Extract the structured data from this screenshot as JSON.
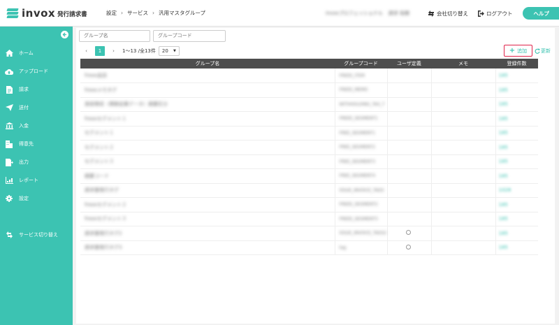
{
  "header": {
    "brand": "invox",
    "product": "発行請求書",
    "breadcrumb": [
      "設定",
      "サービス",
      "汎用マスタグループ"
    ],
    "user_org": "invoxプロフェッショナル",
    "user_name": "請求 佑樹",
    "switch_company": "会社切り替え",
    "logout": "ログアウト",
    "help": "ヘルプ"
  },
  "sidebar": {
    "items": [
      {
        "label": "ホーム",
        "icon": "home-icon"
      },
      {
        "label": "アップロード",
        "icon": "cloud-upload-icon"
      },
      {
        "label": "請求",
        "icon": "document-icon"
      },
      {
        "label": "送付",
        "icon": "send-icon"
      },
      {
        "label": "入金",
        "icon": "bank-icon"
      },
      {
        "label": "得意先",
        "icon": "building-icon"
      },
      {
        "label": "出力",
        "icon": "export-icon"
      },
      {
        "label": "レポート",
        "icon": "chart-icon"
      },
      {
        "label": "設定",
        "icon": "gear-icon"
      },
      {
        "label": "サービス切り替え",
        "icon": "switch-icon"
      }
    ]
  },
  "filters": {
    "group_name_placeholder": "グループ名",
    "group_code_placeholder": "グループコード"
  },
  "pager": {
    "current": "1",
    "info": "1〜13 /全13件",
    "page_size": "20"
  },
  "actions": {
    "add": "追加",
    "refresh": "更新"
  },
  "table": {
    "headers": [
      "グループ名",
      "グループコード",
      "ユーザ定義",
      "メモ",
      "登録件数"
    ],
    "rows": [
      {
        "name": "freee品目",
        "code": "FREEE_ITEM",
        "user_defined": false,
        "memo": "",
        "count": "185"
      },
      {
        "name": "freeeメモタグ",
        "code": "FREEE_MEMO",
        "user_defined": false,
        "memo": "",
        "count": "185"
      },
      {
        "name": "源泉徴収（債務従業データ）摘要区分",
        "code": "WITHHOLDING_TAX_T",
        "user_defined": false,
        "memo": "",
        "count": "185"
      },
      {
        "name": "freeeセグメント１",
        "code": "FREEE_SEGMENT1",
        "user_defined": false,
        "memo": "",
        "count": "185"
      },
      {
        "name": "セグメント１",
        "code": "FREE_SEGMENT1",
        "user_defined": false,
        "memo": "",
        "count": "185"
      },
      {
        "name": "セグメント２",
        "code": "FREE_SEGMENT2",
        "user_defined": false,
        "memo": "",
        "count": "185"
      },
      {
        "name": "セグメント３",
        "code": "FREE_SEGMENT3",
        "user_defined": false,
        "memo": "",
        "count": "185"
      },
      {
        "name": "摘要コード",
        "code": "FREE_SEGMENT4",
        "user_defined": false,
        "memo": "",
        "count": "185"
      },
      {
        "name": "請求書発行タグ",
        "code": "ISSUE_INVOICE_TAGS",
        "user_defined": false,
        "memo": "",
        "count": "1028"
      },
      {
        "name": "freeeセグメント２",
        "code": "FREEE_SEGMENT2",
        "user_defined": false,
        "memo": "",
        "count": "185"
      },
      {
        "name": "freeeセグメント３",
        "code": "FREEE_SEGMENT3",
        "user_defined": false,
        "memo": "",
        "count": "185"
      },
      {
        "name": "請求書発行タグ2",
        "code": "ISSUE_INVOICE_TAGS2",
        "user_defined": true,
        "memo": "",
        "count": "185"
      },
      {
        "name": "請求書発行タグ3",
        "code": "tag",
        "user_defined": true,
        "memo": "",
        "count": "185"
      }
    ]
  },
  "colors": {
    "accent": "#3cc3b2",
    "highlight": "#e0224a",
    "table_header": "#4d4d4d"
  }
}
